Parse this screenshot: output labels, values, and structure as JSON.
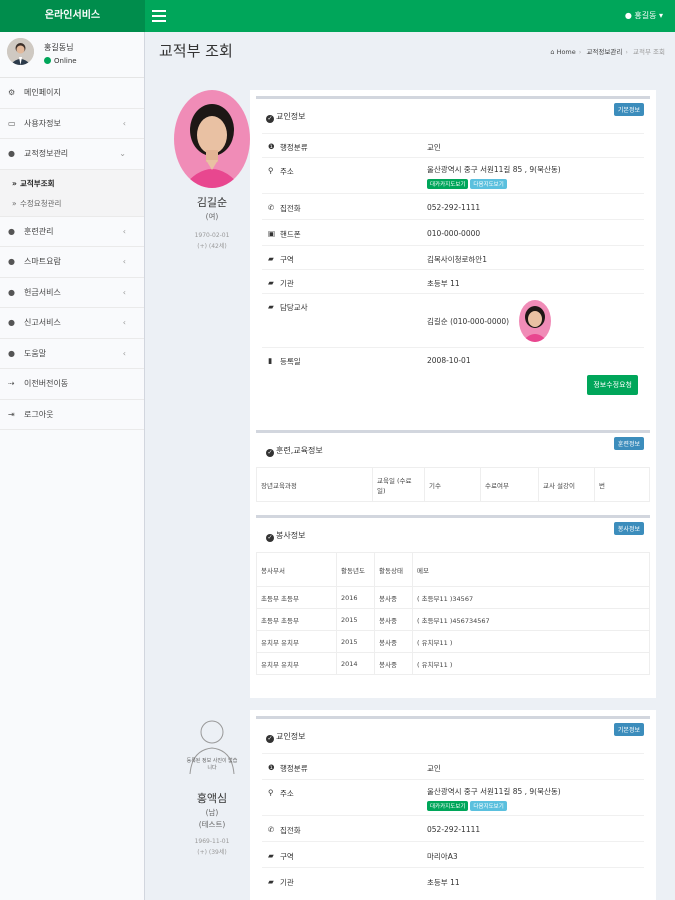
{
  "header": {
    "logo": "온라인서비스",
    "user": "홍길동"
  },
  "sidebar": {
    "user_name": "홍길동님",
    "status": "Online",
    "items": [
      {
        "label": "메인페이지",
        "icon": "dashboard-icon",
        "glyph": "⚙"
      },
      {
        "label": "사용자정보",
        "icon": "laptop-icon",
        "glyph": "▭",
        "chevron": "‹"
      },
      {
        "label": "교적정보관리",
        "icon": "user-icon",
        "glyph": "●",
        "chevron": "⌄"
      },
      {
        "label": "훈련관리",
        "icon": "user-icon",
        "glyph": "●",
        "chevron": "‹"
      },
      {
        "label": "스마트요람",
        "icon": "user-icon",
        "glyph": "●",
        "chevron": "‹"
      },
      {
        "label": "헌금서비스",
        "icon": "user-icon",
        "glyph": "●",
        "chevron": "‹"
      },
      {
        "label": "신고서비스",
        "icon": "user-icon",
        "glyph": "●",
        "chevron": "‹"
      },
      {
        "label": "도움말",
        "icon": "user-icon",
        "glyph": "●",
        "chevron": "‹"
      },
      {
        "label": "이전버전이동",
        "icon": "arrow-icon",
        "glyph": "⇢"
      },
      {
        "label": "로그아웃",
        "icon": "logout-icon",
        "glyph": "⇥"
      }
    ],
    "sub_items": [
      "교적부조회",
      "수정요청관리"
    ]
  },
  "page": {
    "title": "교적부 조회",
    "breadcrumb": [
      "Home",
      "교적정보관리",
      "교적부 조회"
    ]
  },
  "person1": {
    "name": "김길순",
    "gender": "(여)",
    "birth": "1970-02-01",
    "age": "(+) (42세)",
    "info_panel": {
      "title": "교인정보",
      "badge": "기본정보",
      "rows": [
        {
          "icon": "info-icon",
          "glyph": "❶",
          "label": "행정분류",
          "value": "교인"
        },
        {
          "icon": "map-marker-icon",
          "glyph": "⚲",
          "label": "주소",
          "value": "울산광역시 중구 서원11길 85 , 9(북산동)"
        },
        {
          "icon": "phone-icon",
          "glyph": "✆",
          "label": "집전화",
          "value": "052-292-1111"
        },
        {
          "icon": "mobile-icon",
          "glyph": "▣",
          "label": "핸드폰",
          "value": "010-000-0000"
        },
        {
          "icon": "folder-icon",
          "glyph": "▰",
          "label": "구역",
          "value": "김복사이청로하안1"
        },
        {
          "icon": "folder-icon",
          "glyph": "▰",
          "label": "기관",
          "value": "초등부 11"
        },
        {
          "icon": "folder-icon",
          "glyph": "▰",
          "label": "담당교사",
          "value": "김길순 (010-000-0000)"
        },
        {
          "icon": "bookmark-icon",
          "glyph": "▮",
          "label": "등록일",
          "value": "2008-10-01"
        }
      ],
      "map_buttons": [
        "대카카지도보기",
        "다음지도보기"
      ],
      "request_button": "정보수정요청"
    },
    "training_panel": {
      "title": "훈련,교육정보",
      "badge": "훈련정보",
      "headers": [
        "장년교육과정",
        "교육일 (수료일)",
        "기수",
        "수료여부",
        "교사 설강이",
        "번"
      ]
    },
    "service_panel": {
      "title": "봉사정보",
      "badge": "봉사정보",
      "headers": [
        "봉사부서",
        "활동년도",
        "활동상태",
        "메모"
      ],
      "rows": [
        [
          "초등부 초등부",
          "2016",
          "봉사중",
          "( 초등부11 )34567"
        ],
        [
          "초등부 초등부",
          "2015",
          "봉사중",
          "( 초등부11 )456734567"
        ],
        [
          "유치부 유치부",
          "2015",
          "봉사중",
          "( 유치부11 )"
        ],
        [
          "유치부 유치부",
          "2014",
          "봉사중",
          "( 유치부11 )"
        ]
      ]
    }
  },
  "person2": {
    "name": "홍액심",
    "gender": "(남)",
    "tag": "(테스트)",
    "photo_caption": "등록된 정보 사진이 없습니다",
    "birth": "1969-11-01",
    "age": "(+) (39세)",
    "info_panel": {
      "title": "교인정보",
      "badge": "기본정보",
      "rows": [
        {
          "icon": "info-icon",
          "glyph": "❶",
          "label": "행정분류",
          "value": "교인"
        },
        {
          "icon": "map-marker-icon",
          "glyph": "⚲",
          "label": "주소",
          "value": "울산광역시 중구 서원11길 85 , 9(북산동)"
        },
        {
          "icon": "phone-icon",
          "glyph": "✆",
          "label": "집전화",
          "value": "052-292-1111"
        },
        {
          "icon": "folder-icon",
          "glyph": "▰",
          "label": "구역",
          "value": "마리아A3"
        },
        {
          "icon": "folder-icon",
          "glyph": "▰",
          "label": "기관",
          "value": "초등부 11"
        }
      ],
      "map_buttons": [
        "대카카지도보기",
        "다음지도보기"
      ]
    }
  }
}
